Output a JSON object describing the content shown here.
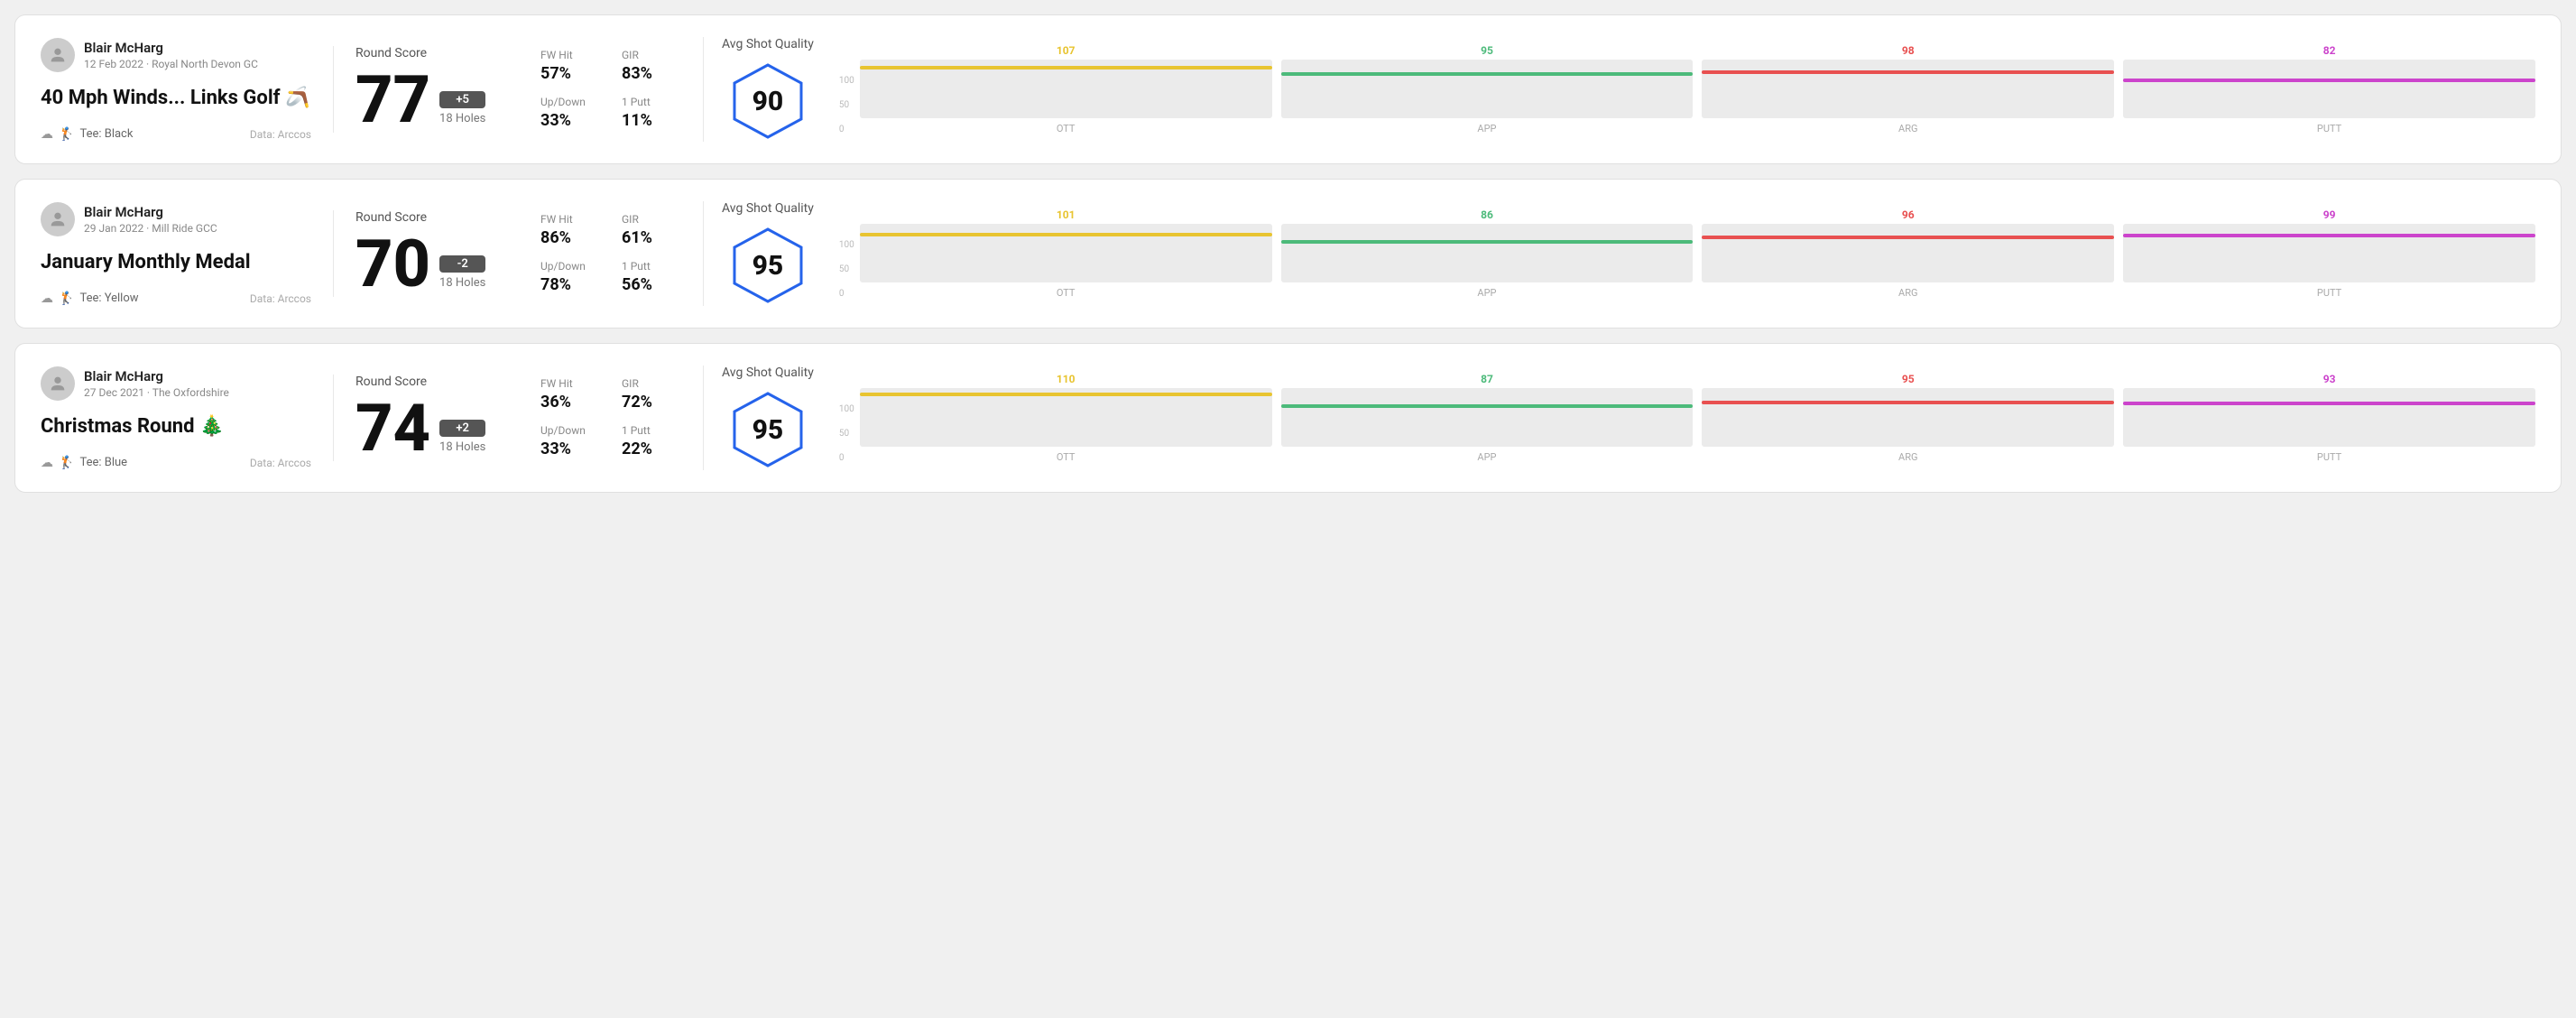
{
  "rounds": [
    {
      "id": "round-1",
      "user": {
        "name": "Blair McHarg",
        "date": "12 Feb 2022",
        "venue": "Royal North Devon GC"
      },
      "title": "40 Mph Winds... Links Golf",
      "title_emoji": "🪃",
      "tee": "Black",
      "data_source": "Data: Arccos",
      "score": {
        "label": "Round Score",
        "number": "77",
        "badge": "+5",
        "holes": "18 Holes"
      },
      "stats": {
        "fw_hit_label": "FW Hit",
        "fw_hit_value": "57%",
        "gir_label": "GIR",
        "gir_value": "83%",
        "updown_label": "Up/Down",
        "updown_value": "33%",
        "oneputt_label": "1 Putt",
        "oneputt_value": "11%"
      },
      "quality": {
        "label": "Avg Shot Quality",
        "score": "90"
      },
      "chart": {
        "bars": [
          {
            "label": "OTT",
            "value": 107,
            "color": "#e8c430"
          },
          {
            "label": "APP",
            "value": 95,
            "color": "#4cba7a"
          },
          {
            "label": "ARG",
            "value": 98,
            "color": "#e85050"
          },
          {
            "label": "PUTT",
            "value": 82,
            "color": "#cc44cc"
          }
        ],
        "max": 120,
        "y_labels": [
          "100",
          "50",
          "0"
        ]
      }
    },
    {
      "id": "round-2",
      "user": {
        "name": "Blair McHarg",
        "date": "29 Jan 2022",
        "venue": "Mill Ride GCC"
      },
      "title": "January Monthly Medal",
      "title_emoji": "",
      "tee": "Yellow",
      "data_source": "Data: Arccos",
      "score": {
        "label": "Round Score",
        "number": "70",
        "badge": "-2",
        "holes": "18 Holes"
      },
      "stats": {
        "fw_hit_label": "FW Hit",
        "fw_hit_value": "86%",
        "gir_label": "GIR",
        "gir_value": "61%",
        "updown_label": "Up/Down",
        "updown_value": "78%",
        "oneputt_label": "1 Putt",
        "oneputt_value": "56%"
      },
      "quality": {
        "label": "Avg Shot Quality",
        "score": "95"
      },
      "chart": {
        "bars": [
          {
            "label": "OTT",
            "value": 101,
            "color": "#e8c430"
          },
          {
            "label": "APP",
            "value": 86,
            "color": "#4cba7a"
          },
          {
            "label": "ARG",
            "value": 96,
            "color": "#e85050"
          },
          {
            "label": "PUTT",
            "value": 99,
            "color": "#cc44cc"
          }
        ],
        "max": 120,
        "y_labels": [
          "100",
          "50",
          "0"
        ]
      }
    },
    {
      "id": "round-3",
      "user": {
        "name": "Blair McHarg",
        "date": "27 Dec 2021",
        "venue": "The Oxfordshire"
      },
      "title": "Christmas Round",
      "title_emoji": "🎄",
      "tee": "Blue",
      "data_source": "Data: Arccos",
      "score": {
        "label": "Round Score",
        "number": "74",
        "badge": "+2",
        "holes": "18 Holes"
      },
      "stats": {
        "fw_hit_label": "FW Hit",
        "fw_hit_value": "36%",
        "gir_label": "GIR",
        "gir_value": "72%",
        "updown_label": "Up/Down",
        "updown_value": "33%",
        "oneputt_label": "1 Putt",
        "oneputt_value": "22%"
      },
      "quality": {
        "label": "Avg Shot Quality",
        "score": "95"
      },
      "chart": {
        "bars": [
          {
            "label": "OTT",
            "value": 110,
            "color": "#e8c430"
          },
          {
            "label": "APP",
            "value": 87,
            "color": "#4cba7a"
          },
          {
            "label": "ARG",
            "value": 95,
            "color": "#e85050"
          },
          {
            "label": "PUTT",
            "value": 93,
            "color": "#cc44cc"
          }
        ],
        "max": 120,
        "y_labels": [
          "100",
          "50",
          "0"
        ]
      }
    }
  ]
}
